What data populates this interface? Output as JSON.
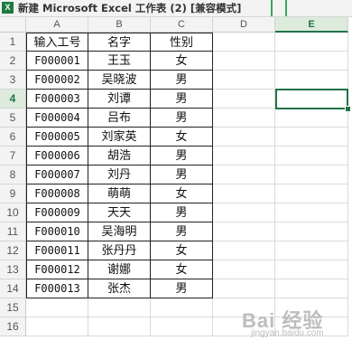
{
  "window": {
    "icon_glyph": "X",
    "title": "新建 Microsoft Excel 工作表 (2)  [兼容模式]"
  },
  "columns": [
    "A",
    "B",
    "C",
    "D",
    "E"
  ],
  "selected_column": "E",
  "selected_row": 4,
  "row_numbers": [
    "1",
    "2",
    "3",
    "4",
    "5",
    "6",
    "7",
    "8",
    "9",
    "10",
    "11",
    "12",
    "13",
    "14",
    "15",
    "16"
  ],
  "table": {
    "headers": [
      "输入工号",
      "名字",
      "性别"
    ],
    "rows": [
      [
        "F000001",
        "王玉",
        "女"
      ],
      [
        "F000002",
        "吴晓波",
        "男"
      ],
      [
        "F000003",
        "刘谭",
        "男"
      ],
      [
        "F000004",
        "吕布",
        "男"
      ],
      [
        "F000005",
        "刘家英",
        "女"
      ],
      [
        "F000006",
        "胡浩",
        "男"
      ],
      [
        "F000007",
        "刘丹",
        "男"
      ],
      [
        "F000008",
        "萌萌",
        "女"
      ],
      [
        "F000009",
        "天天",
        "男"
      ],
      [
        "F000010",
        "吴海明",
        "男"
      ],
      [
        "F000011",
        "张丹丹",
        "女"
      ],
      [
        "F000012",
        "谢娜",
        "女"
      ],
      [
        "F000013",
        "张杰",
        "男"
      ]
    ]
  },
  "watermark": {
    "logo": "Bai 经验",
    "url": "jingyan.baidu.com"
  },
  "colors": {
    "accent": "#217346",
    "grid": "#dadada",
    "border": "#222222"
  }
}
